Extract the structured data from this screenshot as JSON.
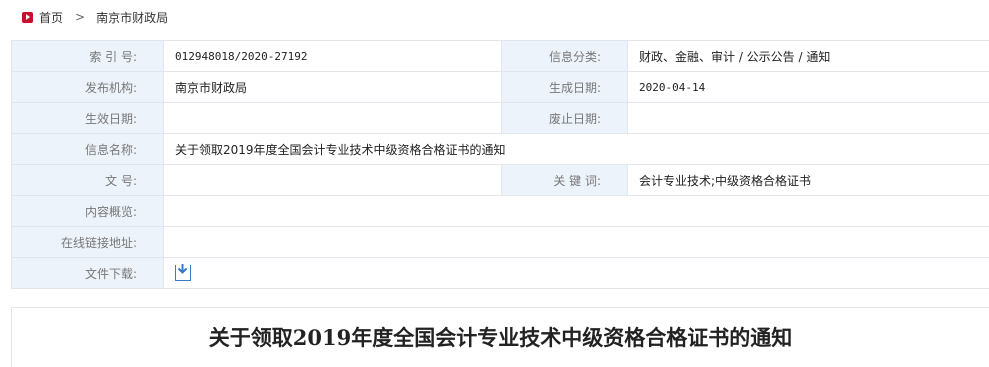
{
  "breadcrumb": {
    "home": "首页",
    "separator": ">",
    "current": "南京市财政局"
  },
  "info": {
    "index_label": "索 引 号:",
    "index_value": "012948018/2020-27192",
    "category_label": "信息分类:",
    "category_value": "财政、金融、审计 / 公示公告 / 通知",
    "publisher_label": "发布机构:",
    "publisher_value": "南京市财政局",
    "created_label": "生成日期:",
    "created_value": "2020-04-14",
    "effective_label": "生效日期:",
    "effective_value": "",
    "expire_label": "废止日期:",
    "expire_value": "",
    "name_label": "信息名称:",
    "name_value": "关于领取2019年度全国会计专业技术中级资格合格证书的通知",
    "docno_label": "文 号:",
    "docno_value": "",
    "keywords_label": "关 键 词:",
    "keywords_value": "会计专业技术;中级资格合格证书",
    "overview_label": "内容概览:",
    "overview_value": "",
    "link_label": "在线链接地址:",
    "link_value": "",
    "download_label": "文件下载:"
  },
  "document": {
    "title": "关于领取2019年度全国会计专业技术中级资格合格证书的通知"
  },
  "colors": {
    "label_bg": "#edf3fb",
    "border": "#e2e6ec",
    "home_icon": "#c8102e",
    "download_icon": "#3a78c7"
  },
  "icons": {
    "home": "home-icon",
    "download": "download-icon"
  }
}
